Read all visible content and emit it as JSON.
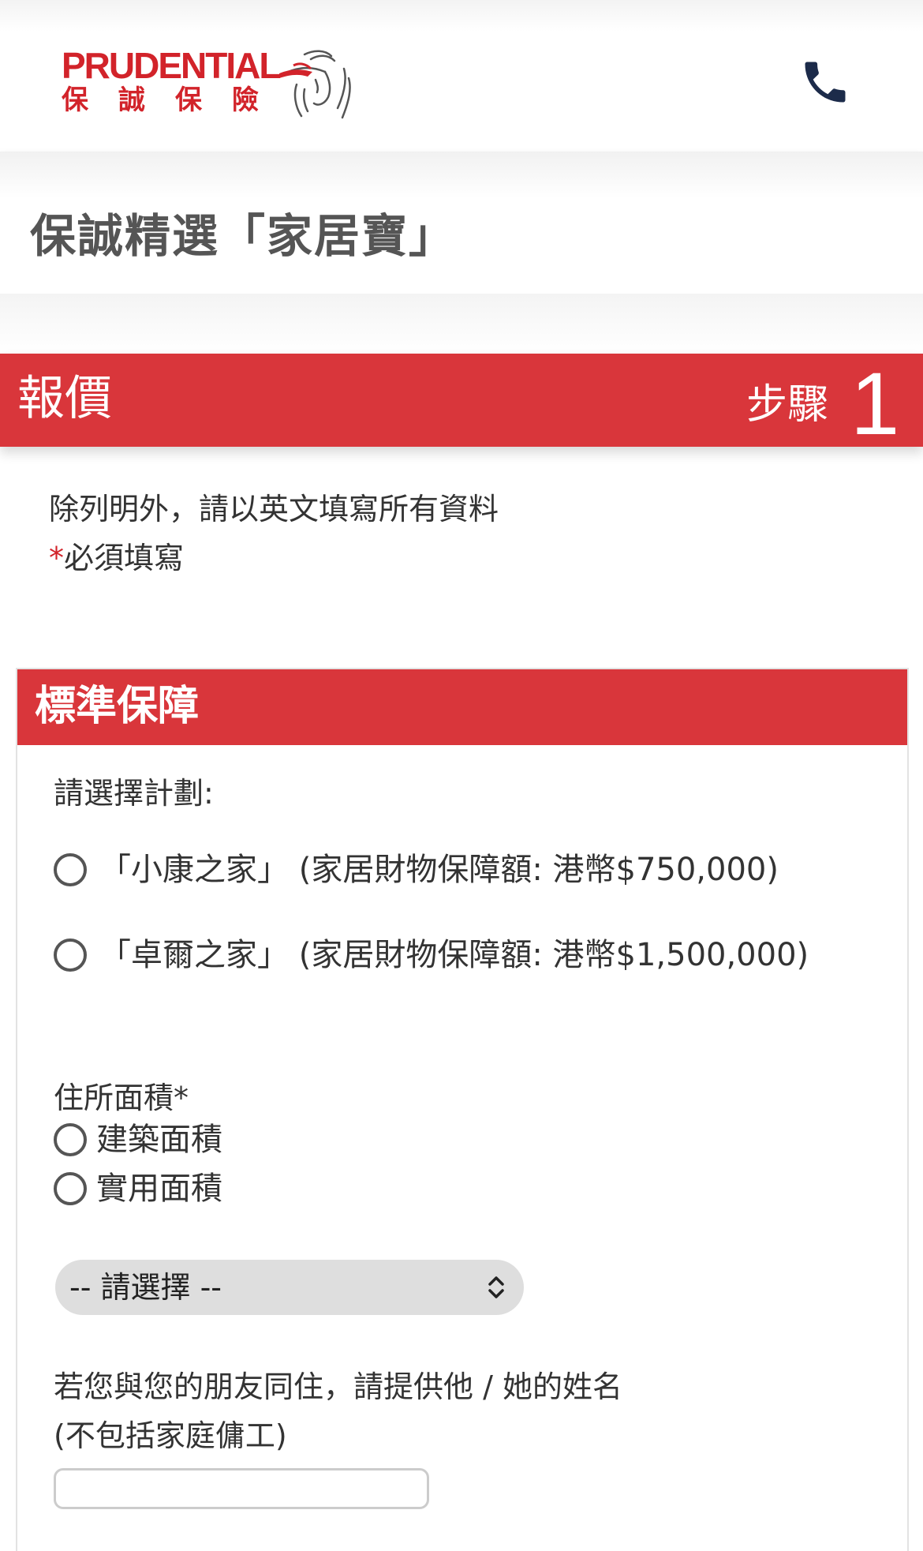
{
  "header": {
    "logo_en": "PRUDENTIAL",
    "logo_zh": [
      "保",
      "誠",
      "保",
      "險"
    ],
    "brand_color": "#d2232a",
    "phone_icon": "phone-icon"
  },
  "product": {
    "title": "保誠精選「家居寶」"
  },
  "step": {
    "title": "報價",
    "label": "步驟",
    "number": "1"
  },
  "instructions": {
    "line1": "除列明外，請以英文填寫所有資料",
    "required_star": "*",
    "required_text": "必須填寫"
  },
  "section": {
    "title": "標準保障",
    "plan_label": "請選擇計劃:",
    "plans": [
      {
        "label": "「小康之家」 (家居財物保障額: 港幣$750,000)"
      },
      {
        "label": "「卓爾之家」 (家居財物保障額: 港幣$1,500,000)"
      }
    ],
    "area_label": "住所面積*",
    "area_options": [
      {
        "label": "建築面積"
      },
      {
        "label": "實用面積"
      }
    ],
    "area_select": {
      "value": "-- 請選擇 --"
    },
    "friend_label_line1": "若您與您的朋友同住，請提供他 / 她的姓名",
    "friend_label_line2": "(不包括家庭傭工)",
    "friend_input_value": ""
  },
  "colors": {
    "accent_red": "#d9363b",
    "navy_icon": "#1c2b4a"
  }
}
